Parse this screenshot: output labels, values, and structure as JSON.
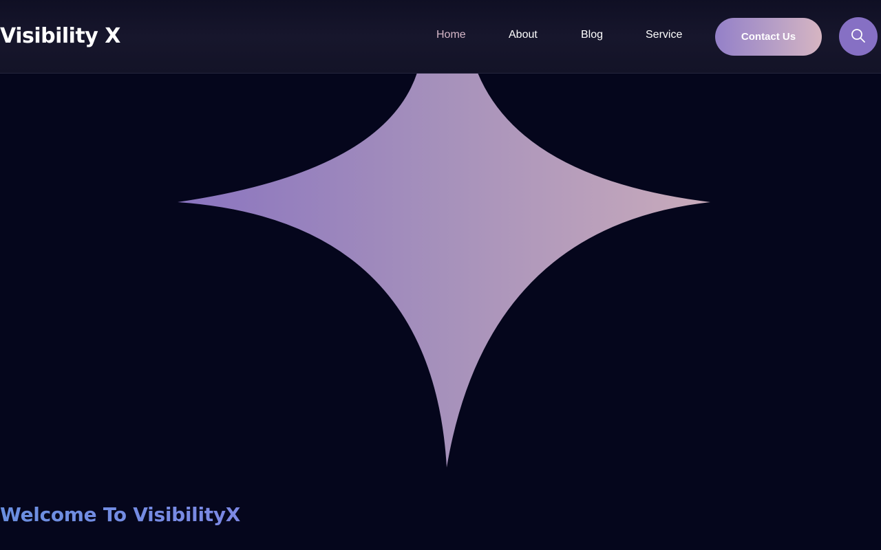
{
  "header": {
    "logo": "Visibility X",
    "nav": {
      "home": "Home",
      "about": "About",
      "blog": "Blog",
      "service": "Service"
    },
    "active_nav": "Home",
    "contact_button": "Contact Us",
    "search_icon": "search-icon"
  },
  "hero": {
    "decoration": "four-point-star",
    "star_gradient": [
      "#8e78c2",
      "#a691bb",
      "#c7a9bb"
    ]
  },
  "welcome": {
    "heading": "Welcome To VisibilityX"
  },
  "colors": {
    "background": "#05061c",
    "accent": "#8670c4",
    "active_link": "#d6b7c8",
    "heading": "#6d8ee0"
  }
}
